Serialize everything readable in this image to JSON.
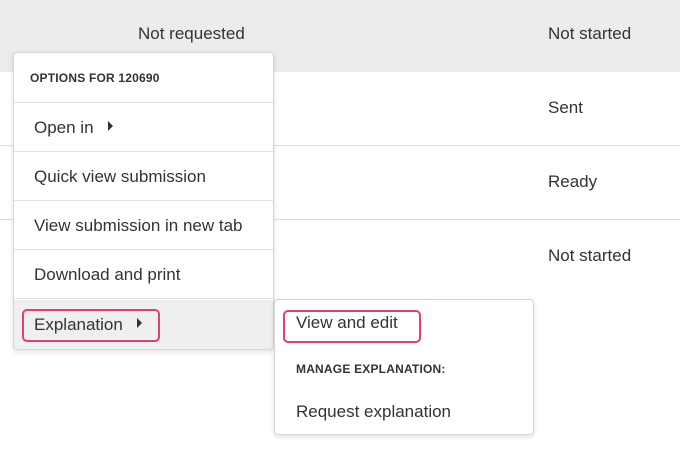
{
  "table": {
    "rows": [
      {
        "request": "Not requested",
        "status": "Not started"
      },
      {
        "request": "",
        "status": "Sent"
      },
      {
        "request": "",
        "status": "Ready"
      },
      {
        "request": "",
        "status": "Not started"
      }
    ]
  },
  "menu": {
    "header": "OPTIONS FOR 120690",
    "items": [
      {
        "label": "Open in"
      },
      {
        "label": "Quick view submission"
      },
      {
        "label": "View submission in new tab"
      },
      {
        "label": "Download and print"
      },
      {
        "label": "Explanation"
      }
    ]
  },
  "submenu": {
    "view_edit": "View and edit",
    "section_label": "MANAGE EXPLANATION:",
    "request": "Request explanation"
  },
  "colors": {
    "highlight": "#e0406e",
    "header_bg": "#ececec",
    "active_item_bg": "#efefef"
  }
}
